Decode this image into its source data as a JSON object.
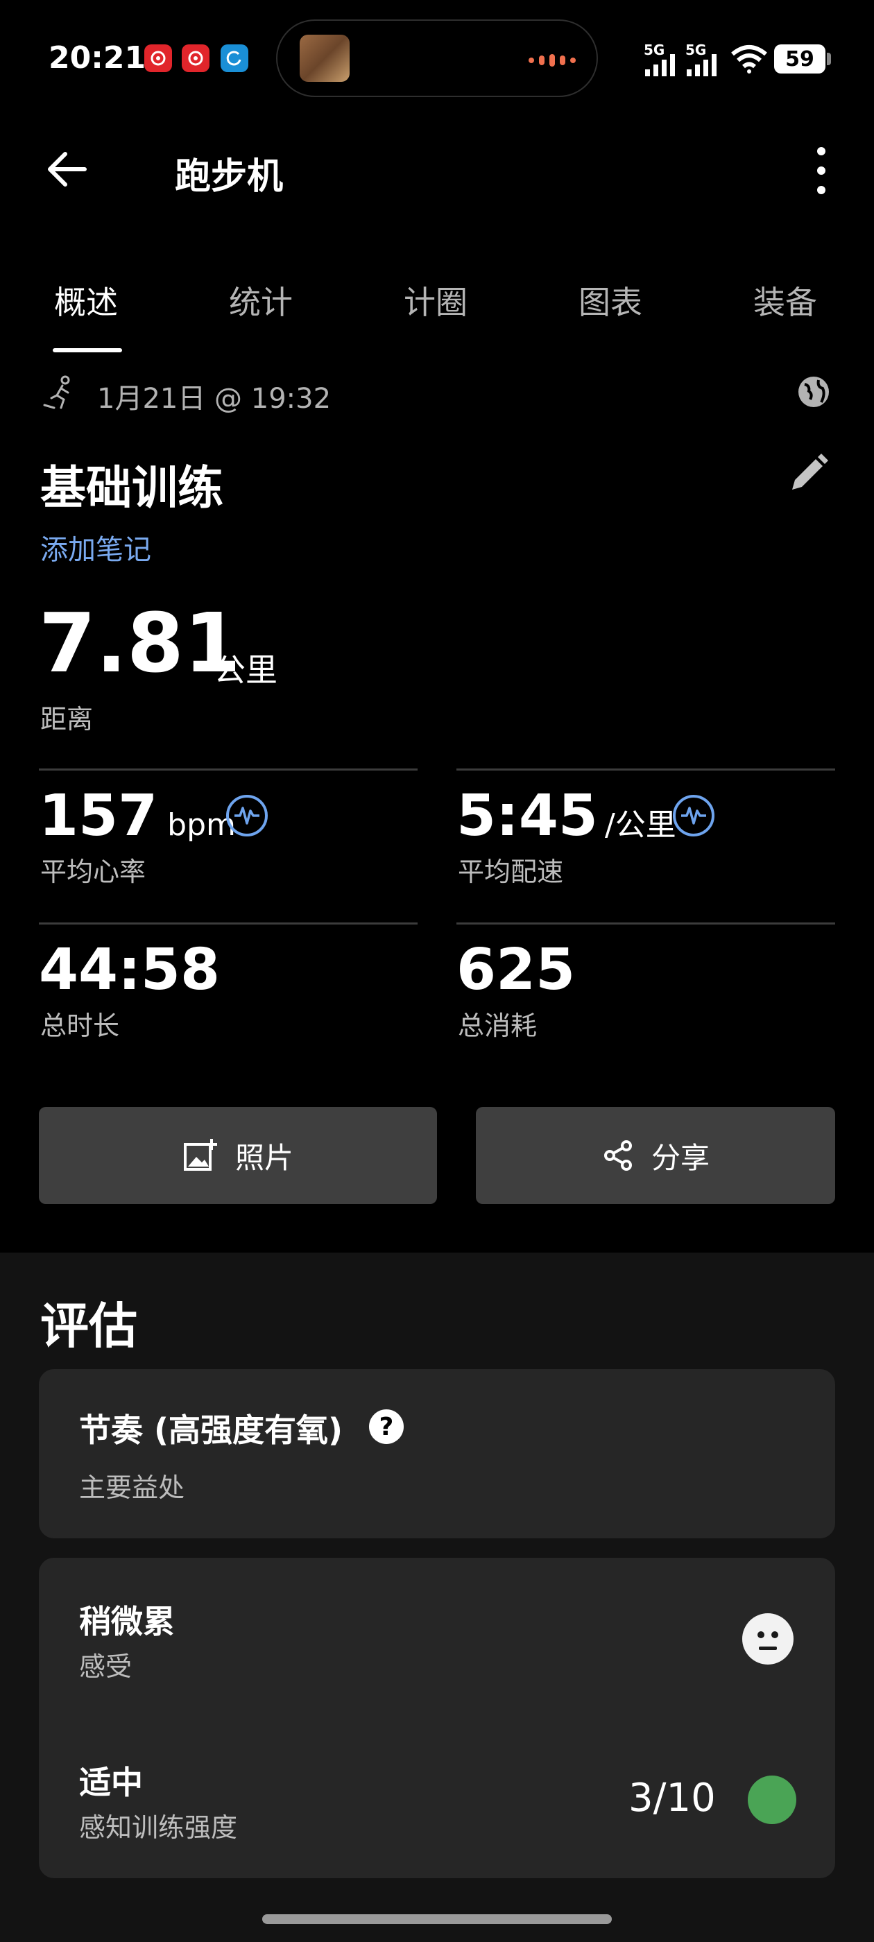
{
  "status_bar": {
    "time": "20:21",
    "network_1": "5G",
    "network_2": "5G",
    "battery": "59",
    "icons": [
      "app-notification-icon",
      "app-notification-icon",
      "app-sync-icon",
      "signal-icon",
      "signal-icon",
      "wifi-icon",
      "battery-icon"
    ]
  },
  "header": {
    "title": "跑步机",
    "back_icon": "arrow-left-icon",
    "menu_icon": "more-vertical-icon"
  },
  "tabs": [
    {
      "label": "概述",
      "active": true
    },
    {
      "label": "统计",
      "active": false
    },
    {
      "label": "计圈",
      "active": false
    },
    {
      "label": "图表",
      "active": false
    },
    {
      "label": "装备",
      "active": false
    }
  ],
  "activity": {
    "datetime": "1月21日 @ 19:32",
    "name": "基础训练",
    "add_note": "添加笔记"
  },
  "distance": {
    "value": "7.81",
    "unit": "公里",
    "label": "距离"
  },
  "stats": {
    "heart_rate": {
      "value": "157",
      "unit": "bpm",
      "label": "平均心率"
    },
    "pace": {
      "value": "5:45",
      "unit": "/公里",
      "label": "平均配速"
    },
    "duration": {
      "value": "44:58",
      "label": "总时长"
    },
    "calories": {
      "value": "625",
      "label": "总消耗"
    }
  },
  "buttons": {
    "photo": "照片",
    "share": "分享"
  },
  "assessment": {
    "title": "评估",
    "benefit": {
      "title": "节奏 (高强度有氧)",
      "subtitle": "主要益处",
      "help": "?"
    },
    "feel": {
      "title": "稍微累",
      "subtitle": "感受"
    },
    "effort": {
      "title": "适中",
      "subtitle": "感知训练强度",
      "score": "3/10"
    }
  },
  "colors": {
    "background": "#000000",
    "accent_link": "#7aaaf0",
    "button_bg": "#3f3f3f",
    "card_bg": "#262626",
    "effort_indicator": "#4aa455"
  }
}
